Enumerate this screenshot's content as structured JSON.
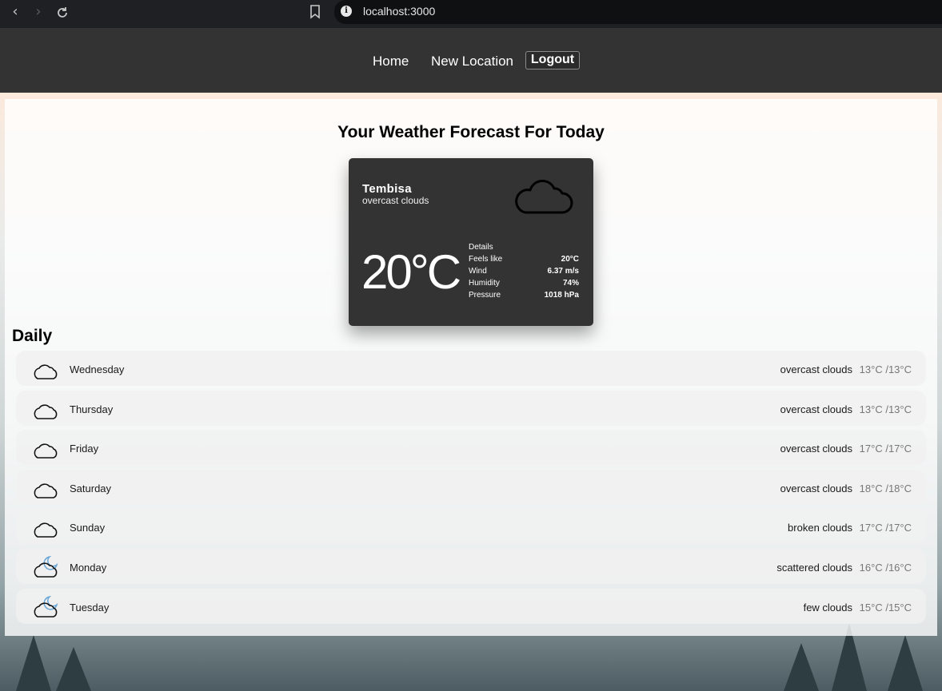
{
  "browser": {
    "url": "localhost:3000",
    "back_icon": "chevron-left-icon",
    "forward_icon": "chevron-right-icon",
    "reload_icon": "reload-icon"
  },
  "nav": {
    "home": "Home",
    "new_location": "New Location",
    "logout": "Logout"
  },
  "page_title": "Your Weather Forecast For Today",
  "current": {
    "city": "Tembisa",
    "description": "overcast clouds",
    "temperature": "20°C",
    "icon": "cloud-icon",
    "details_label": "Details",
    "details": [
      {
        "label": "Feels like",
        "value": "20°C"
      },
      {
        "label": "Wind",
        "value": "6.37 m/s"
      },
      {
        "label": "Humidity",
        "value": "74%"
      },
      {
        "label": "Pressure",
        "value": "1018 hPa"
      }
    ]
  },
  "daily_title": "Daily",
  "daily": [
    {
      "day": "Wednesday",
      "description": "overcast clouds",
      "temps": "13°C /13°C",
      "icon": "cloud"
    },
    {
      "day": "Thursday",
      "description": "overcast clouds",
      "temps": "13°C /13°C",
      "icon": "cloud"
    },
    {
      "day": "Friday",
      "description": "overcast clouds",
      "temps": "17°C /17°C",
      "icon": "cloud"
    },
    {
      "day": "Saturday",
      "description": "overcast clouds",
      "temps": "18°C /18°C",
      "icon": "cloud"
    },
    {
      "day": "Sunday",
      "description": "broken clouds",
      "temps": "17°C /17°C",
      "icon": "cloud"
    },
    {
      "day": "Monday",
      "description": "scattered clouds",
      "temps": "16°C /16°C",
      "icon": "cloud-moon"
    },
    {
      "day": "Tuesday",
      "description": "few clouds",
      "temps": "15°C /15°C",
      "icon": "cloud-moon"
    }
  ],
  "colors": {
    "header_bg": "#333333",
    "card_bg": "#333333",
    "moon_accent": "#6aa6d6"
  }
}
